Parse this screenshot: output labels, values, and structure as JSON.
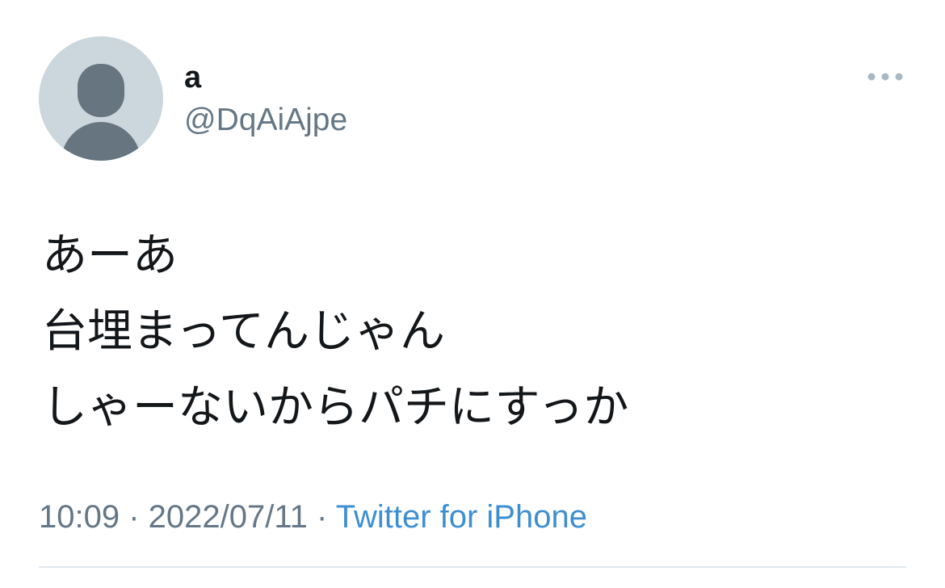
{
  "user": {
    "display_name": "a",
    "handle": "@DqAiAjpe"
  },
  "tweet": {
    "lines": [
      "あーあ",
      "台埋まってんじゃん",
      "しゃーないからパチにすっか"
    ]
  },
  "meta": {
    "time": "10:09",
    "separator": " · ",
    "date": "2022/07/11",
    "source": "Twitter for iPhone"
  },
  "colors": {
    "text": "#14171a",
    "secondary": "#657786",
    "link": "#3d8fd1",
    "avatar_bg": "#ccd6dd",
    "avatar_figure": "#66757f",
    "divider": "#e1e8ed"
  },
  "icons": {
    "avatar": "default-profile-icon",
    "more": "more-horizontal-icon"
  }
}
